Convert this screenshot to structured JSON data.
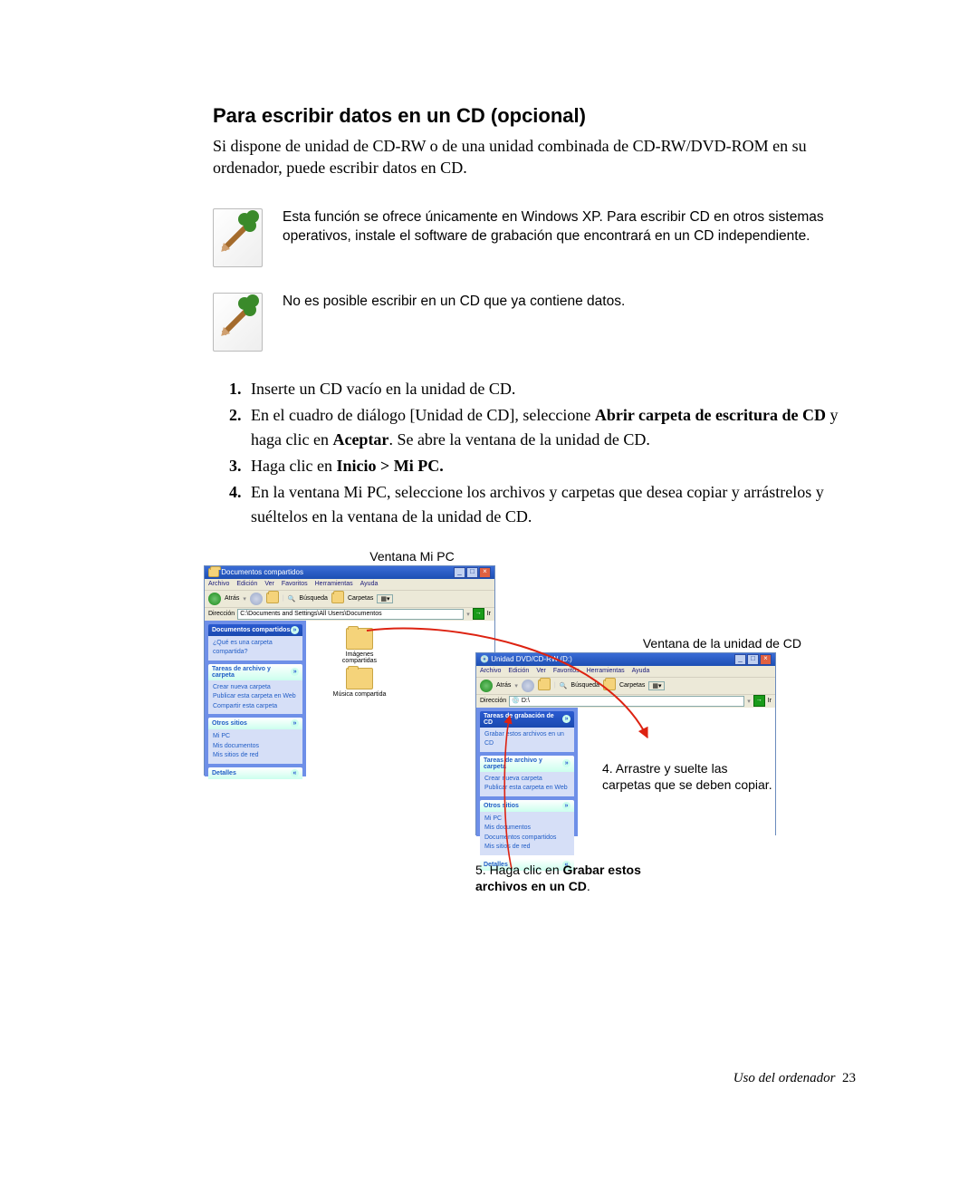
{
  "heading": "Para escribir datos en un CD (opcional)",
  "intro": "Si dispone de unidad de CD-RW o de una unidad combinada de CD-RW/DVD-ROM en su ordenador, puede escribir datos en CD.",
  "note1": "Esta función se ofrece únicamente en Windows XP. Para escribir CD en otros sistemas operativos, instale el software de grabación que encontrará en un CD independiente.",
  "note2": "No es posible escribir en un CD que ya contiene datos.",
  "steps": {
    "s1": "Inserte un CD vacío en la unidad de CD.",
    "s2_a": "En el cuadro de diálogo [Unidad de CD], seleccione ",
    "s2_b": "Abrir carpeta de escritura de CD",
    "s2_c": "  y haga clic en ",
    "s2_d": "Aceptar",
    "s2_e": ". Se abre la ventana de la unidad de CD.",
    "s3_a": "Haga clic en ",
    "s3_b": "Inicio > Mi PC.",
    "s4": "En la ventana Mi PC, seleccione los archivos y carpetas que desea copiar y arrástrelos y suéltelos en la ventana de la unidad de CD."
  },
  "fig": {
    "label_left": "Ventana Mi PC",
    "label_right": "Ventana de la unidad de CD",
    "callout4_a": "4. Arrastre y suelte las carpetas que se deben copiar.",
    "callout5_a": "5. Haga clic en ",
    "callout5_b": "Grabar estos archivos en un CD",
    "callout5_c": "."
  },
  "shot1": {
    "title": "Documentos compartidos",
    "menu": [
      "Archivo",
      "Edición",
      "Ver",
      "Favoritos",
      "Herramientas",
      "Ayuda"
    ],
    "tb_back": "Atrás",
    "tb_search": "Búsqueda",
    "tb_folders": "Carpetas",
    "addr_label": "Dirección",
    "addr_path": "C:\\Documents and Settings\\All Users\\Documentos",
    "panels": {
      "p1_title": "Documentos compartidos",
      "p1_item": "¿Qué es una carpeta compartida?",
      "p2_title": "Tareas de archivo y carpeta",
      "p2_items": [
        "Crear nueva carpeta",
        "Publicar esta carpeta en Web",
        "Compartir esta carpeta"
      ],
      "p3_title": "Otros sitios",
      "p3_items": [
        "Mi PC",
        "Mis documentos",
        "Mis sitios de red"
      ],
      "p4_title": "Detalles"
    },
    "folders": {
      "f1": "Imágenes compartidas",
      "f2": "Música compartida"
    }
  },
  "shot2": {
    "title": "Unidad DVD/CD-RW (D:)",
    "menu": [
      "Archivo",
      "Edición",
      "Ver",
      "Favoritos",
      "Herramientas",
      "Ayuda"
    ],
    "tb_back": "Atrás",
    "tb_search": "Búsqueda",
    "tb_folders": "Carpetas",
    "addr_label": "Dirección",
    "addr_path": "D:\\",
    "panels": {
      "p1_title": "Tareas de grabación de CD",
      "p1_item": "Grabar estos archivos en un CD",
      "p2_title": "Tareas de archivo y carpeta",
      "p2_items": [
        "Crear nueva carpeta",
        "Publicar esta carpeta en Web"
      ],
      "p3_title": "Otros sitios",
      "p3_items": [
        "Mi PC",
        "Mis documentos",
        "Documentos compartidos",
        "Mis sitios de red"
      ],
      "p4_title": "Detalles"
    }
  },
  "footer": {
    "text": "Uso del ordenador",
    "page": "23"
  }
}
